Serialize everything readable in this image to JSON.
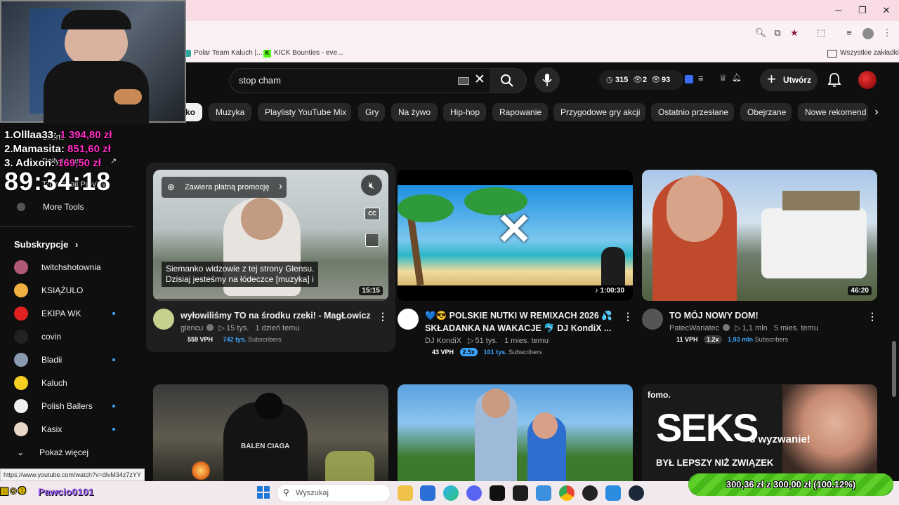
{
  "browser": {
    "bookmarks": [
      "Polar Team Kaluch |...",
      "KICK Bounties - eve..."
    ],
    "all_bookmarks": "Wszystkie zakładki"
  },
  "search": {
    "value": "stop cham"
  },
  "header": {
    "stats": [
      "315",
      "2",
      "93"
    ],
    "create_label": "Utwórz"
  },
  "chips": [
    "ko",
    "Muzyka",
    "Playlisty YouTube Mix",
    "Gry",
    "Na żywo",
    "Hip-hop",
    "Rapowanie",
    "Przygodowe gry akcji",
    "Ostatnio przesłane",
    "Obejrzane",
    "Nowe rekomend"
  ],
  "sidebar": {
    "partial_items": [
      "Shorts",
      "Daily Ideas",
      "Thumbnail Preview"
    ],
    "more_tools": "More Tools",
    "subs_heading": "Subskrypcje",
    "subscriptions": [
      "twitchshotownia",
      "KSIĄŻULO",
      "EKIPA WK",
      "covin",
      "Bladii",
      "Kaluch",
      "Polish Ballers",
      "Kasix"
    ],
    "show_more": "Pokaż więcej"
  },
  "stream_overlay": {
    "donors": [
      {
        "label": "1.Olllaa33:",
        "amount": "1 394,80 zł"
      },
      {
        "label": "2.Mamasita:",
        "amount": "851,60 zł"
      },
      {
        "label": "3. Adixon:",
        "amount": "169,50 zł"
      }
    ],
    "timer": "89:34:18",
    "streamer": "Pawcio0101",
    "goal_text": "300,36 zł z 300,00 zł (100.12%)",
    "goal_progress": 1.0012
  },
  "status_url": "https://www.youtube.com/watch?v=dlvM34z7zYY",
  "videos": [
    {
      "title": "wyłowiliśmy TO na środku rzeki! - MagŁowicz",
      "channel": "glencu",
      "views": "15 tys.",
      "age": "1 dzień temu",
      "vph": "559 VPH",
      "subs": "742 tys.",
      "duration": "15:15",
      "promo": "Zawiera płatną promocję",
      "captions": [
        "Siemanko widzowie z tej strony Glensu.",
        "Dzisiaj jesteśmy na łódeczce [muzyka] i"
      ]
    },
    {
      "title": "💙😎 POLSKIE NUTKI W REMIXACH 2026 💦 SKŁADANKA NA WAKACJE 🐬 DJ KondiX ...",
      "channel": "DJ KondiX",
      "views": "51 tys.",
      "age": "1 mies. temu",
      "vph": "43 VPH",
      "multiplier": "2.5x",
      "subs": "101 tys.",
      "duration": "1:00:30"
    },
    {
      "title": "TO MÓJ NOWY DOM!",
      "channel": "PatecWariatec",
      "views": "1,1 mln",
      "age": "5 mies. temu",
      "vph": "11 VPH",
      "multiplier": "1.2x",
      "subs": "1,93 mln",
      "duration": "46:20"
    }
  ],
  "subscribers_label": "Subscribers",
  "row2": {
    "seks_text": "SEKS",
    "challenge": "8 wyzwanie!",
    "bottom_text": "BYŁ LEPSZY NIŻ ZWIĄZEK",
    "logo": "fomo.",
    "jacket": "BALEN CIAGA"
  },
  "taskbar": {
    "search_placeholder": "Wyszukaj"
  }
}
